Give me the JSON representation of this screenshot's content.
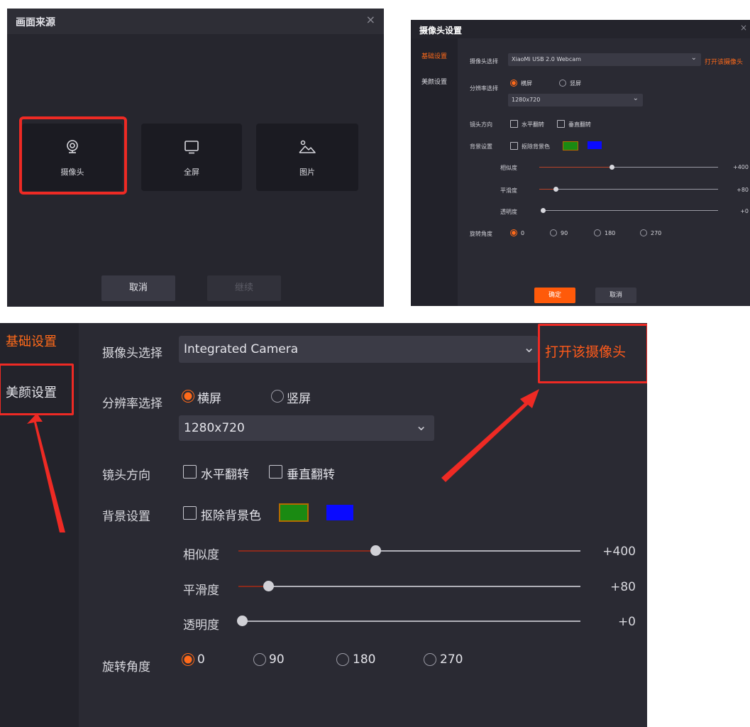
{
  "source_dialog": {
    "title": "画面来源",
    "close_glyph": "×",
    "cards": [
      {
        "label": "摄像头",
        "icon": "webcam-icon"
      },
      {
        "label": "全屏",
        "icon": "monitor-icon"
      },
      {
        "label": "图片",
        "icon": "image-icon"
      }
    ],
    "cancel_label": "取消",
    "continue_label": "继续"
  },
  "camera_settings_small": {
    "title": "摄像头设置",
    "close_glyph": "×",
    "tabs": [
      "基础设置",
      "美颜设置"
    ],
    "camera_select_label": "摄像头选择",
    "camera_value": "XiaoMi USB 2.0 Webcam",
    "open_camera_label": "打开该摄像头",
    "resolution_label": "分辨率选择",
    "orientation_options": [
      "横屏",
      "竖屏"
    ],
    "resolution_value": "1280x720",
    "lens_label": "镜头方向",
    "flip_options": [
      "水平翻转",
      "垂直翻转"
    ],
    "background_label": "背景设置",
    "remove_bg_label": "抠除背景色",
    "sliders": [
      {
        "label": "相似度",
        "value": "+400"
      },
      {
        "label": "平滑度",
        "value": "+80"
      },
      {
        "label": "透明度",
        "value": "+0"
      }
    ],
    "rotation_label": "旋转角度",
    "rotation_options": [
      "0",
      "90",
      "180",
      "270"
    ],
    "confirm_label": "确定",
    "cancel_label": "取消"
  },
  "camera_settings_zoom": {
    "tabs": [
      "基础设置",
      "美颜设置"
    ],
    "camera_select_label": "摄像头选择",
    "camera_value": "Integrated Camera",
    "open_camera_label": "打开该摄像头",
    "resolution_label": "分辨率选择",
    "orientation_options": [
      "横屏",
      "竖屏"
    ],
    "resolution_value": "1280x720",
    "lens_label": "镜头方向",
    "flip_options": [
      "水平翻转",
      "垂直翻转"
    ],
    "background_label": "背景设置",
    "remove_bg_label": "抠除背景色",
    "sliders": [
      {
        "label": "相似度",
        "value": "+400"
      },
      {
        "label": "平滑度",
        "value": "+80"
      },
      {
        "label": "透明度",
        "value": "+0"
      }
    ],
    "rotation_label": "旋转角度",
    "rotation_options": [
      "0",
      "90",
      "180",
      "270"
    ]
  },
  "colors": {
    "accent_orange": "#ff6a1a",
    "highlight_red": "#ee2a24",
    "bg_swatch_green": "#1a8a12",
    "bg_swatch_blue": "#0a0aff"
  }
}
